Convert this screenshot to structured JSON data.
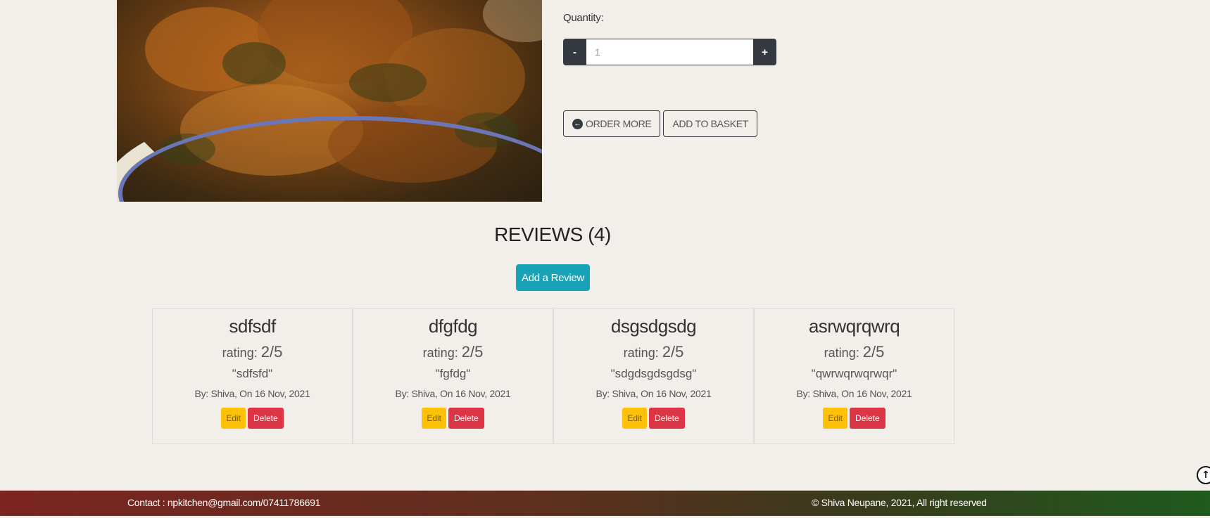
{
  "product": {
    "image_alt": "food dish"
  },
  "quantity": {
    "label": "Quantity:",
    "minus_label": "-",
    "value": "1",
    "plus_label": "+"
  },
  "actions": {
    "order_more_icon": "arrow-circle-left-icon",
    "order_more_label": "ORDER MORE",
    "add_to_basket_label": "ADD TO BASKET"
  },
  "reviews": {
    "heading": "REVIEWS (4)",
    "add_review_label": "Add a Review",
    "items": [
      {
        "title": "sdfsdf",
        "rating_label": "rating:",
        "rating_value": "2/5",
        "text": "\"sdfsfd\"",
        "meta": "By: Shiva, On 16 Nov, 2021",
        "edit_label": "Edit",
        "delete_label": "Delete"
      },
      {
        "title": "dfgfdg",
        "rating_label": "rating:",
        "rating_value": "2/5",
        "text": "\"fgfdg\"",
        "meta": "By: Shiva, On 16 Nov, 2021",
        "edit_label": "Edit",
        "delete_label": "Delete"
      },
      {
        "title": "dsgsdgsdg",
        "rating_label": "rating:",
        "rating_value": "2/5",
        "text": "\"sdgdsgdsgdsg\"",
        "meta": "By: Shiva, On 16 Nov, 2021",
        "edit_label": "Edit",
        "delete_label": "Delete"
      },
      {
        "title": "asrwqrqwrq",
        "rating_label": "rating:",
        "rating_value": "2/5",
        "text": "\"qwrwqrwqrwqr\"",
        "meta": "By: Shiva, On 16 Nov, 2021",
        "edit_label": "Edit",
        "delete_label": "Delete"
      }
    ]
  },
  "scroll_top": {
    "icon": "arrow-up-circle-icon",
    "glyph": "↑"
  },
  "footer": {
    "contact": "Contact : npkitchen@gmail.com/07411786691",
    "copyright": "© Shiva Neupane, 2021, All right reserved"
  },
  "colors": {
    "page_background": "#f2efeb",
    "dark_button": "#343a40",
    "info_button": "#17a2b8",
    "edit_button": "#ffc107",
    "delete_button": "#dc3545",
    "footer_start": "#7b2421",
    "footer_end": "#1f5a1e"
  }
}
